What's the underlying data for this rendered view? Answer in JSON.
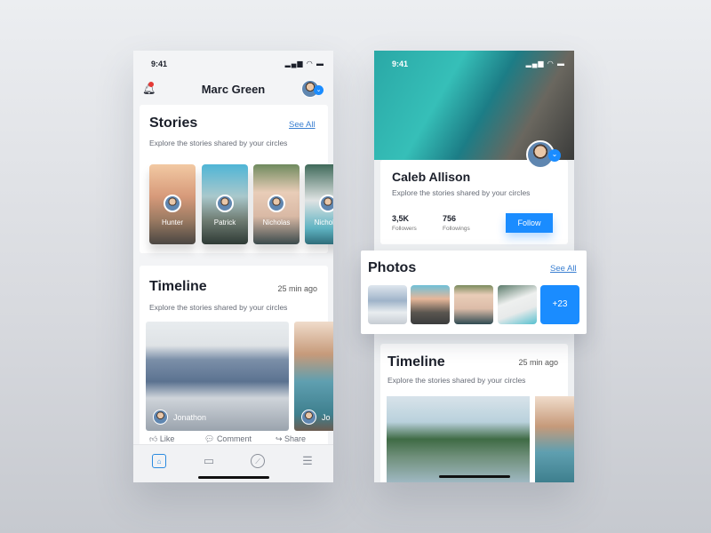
{
  "left": {
    "status_time": "9:41",
    "title": "Marc Green",
    "stories": {
      "title": "Stories",
      "see_all": "See All",
      "subtitle": "Explore the stories shared by your circles",
      "items": [
        {
          "name": "Hunter"
        },
        {
          "name": "Patrick"
        },
        {
          "name": "Nicholas"
        },
        {
          "name": "Nicholas"
        }
      ]
    },
    "timeline": {
      "title": "Timeline",
      "time": "25 min ago",
      "subtitle": "Explore the stories shared by your circles",
      "posts": [
        {
          "author": "Jonathon"
        },
        {
          "author": "Jo"
        }
      ],
      "actions": {
        "like": "Like",
        "comment": "Comment",
        "share": "Share"
      }
    },
    "tabs": [
      "home-icon",
      "chat-icon",
      "compass-icon",
      "filter-icon"
    ]
  },
  "right": {
    "status_time": "9:41",
    "profile": {
      "name": "Caleb Allison",
      "subtitle": "Explore the stories shared by your circles",
      "followers_value": "3,5K",
      "followers_label": "Followers",
      "followings_value": "756",
      "followings_label": "Followings",
      "follow": "Follow"
    },
    "photos": {
      "title": "Photos",
      "see_all": "See All",
      "more": "+23"
    },
    "timeline": {
      "title": "Timeline",
      "time": "25 min ago",
      "subtitle": "Explore the stories shared by your circles"
    }
  },
  "colors": {
    "accent": "#1a8cff",
    "notification": "#e53935"
  }
}
